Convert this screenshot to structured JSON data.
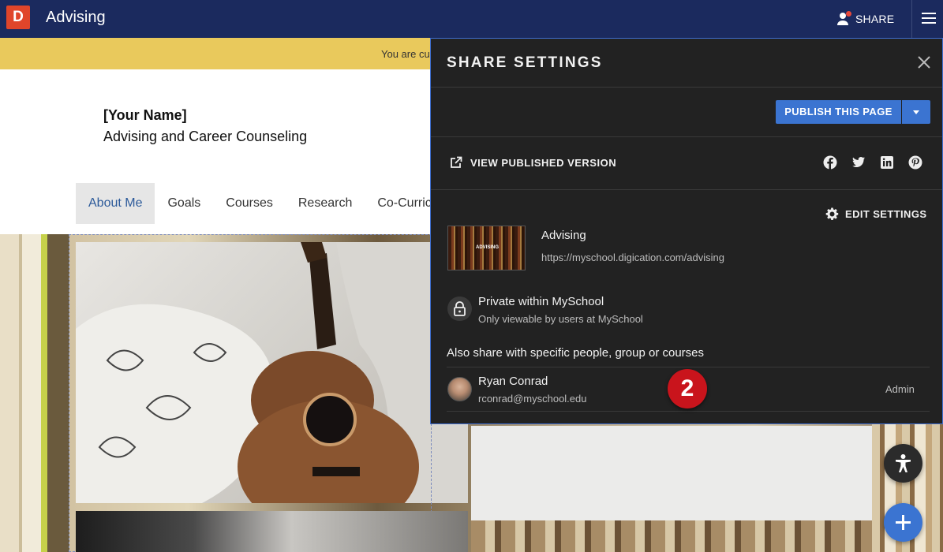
{
  "topbar": {
    "logo_letter": "D",
    "app_title": "Advising",
    "share_label": "SHARE"
  },
  "banner": {
    "text": "You are cu"
  },
  "page": {
    "owner_name": "[Your Name]",
    "subtitle": "Advising and Career Counseling",
    "tabs": [
      {
        "label": "About Me",
        "active": true
      },
      {
        "label": "Goals"
      },
      {
        "label": "Courses"
      },
      {
        "label": "Research"
      },
      {
        "label": "Co-Curricu"
      }
    ]
  },
  "share_panel": {
    "title": "SHARE SETTINGS",
    "publish_label": "PUBLISH THIS PAGE",
    "view_published_label": "VIEW PUBLISHED VERSION",
    "social_icons": [
      "facebook-icon",
      "twitter-icon",
      "linkedin-icon",
      "pinterest-icon"
    ],
    "edit_settings_label": "EDIT SETTINGS",
    "site": {
      "thumbnail_label": "ADVISING",
      "name": "Advising",
      "url": "https://myschool.digication.com/advising"
    },
    "privacy": {
      "title": "Private within MySchool",
      "description": "Only viewable by users at MySchool"
    },
    "also_share_label": "Also share with specific people, group or courses",
    "users": [
      {
        "name": "Ryan Conrad",
        "email": "rconrad@myschool.edu",
        "role": "Admin"
      }
    ]
  },
  "step_badge": "2",
  "colors": {
    "topbar": "#1b2a5e",
    "logo": "#e0452a",
    "banner": "#e9c95c",
    "panel": "#222222",
    "accent": "#3b74d1",
    "badge": "#c9141c"
  }
}
